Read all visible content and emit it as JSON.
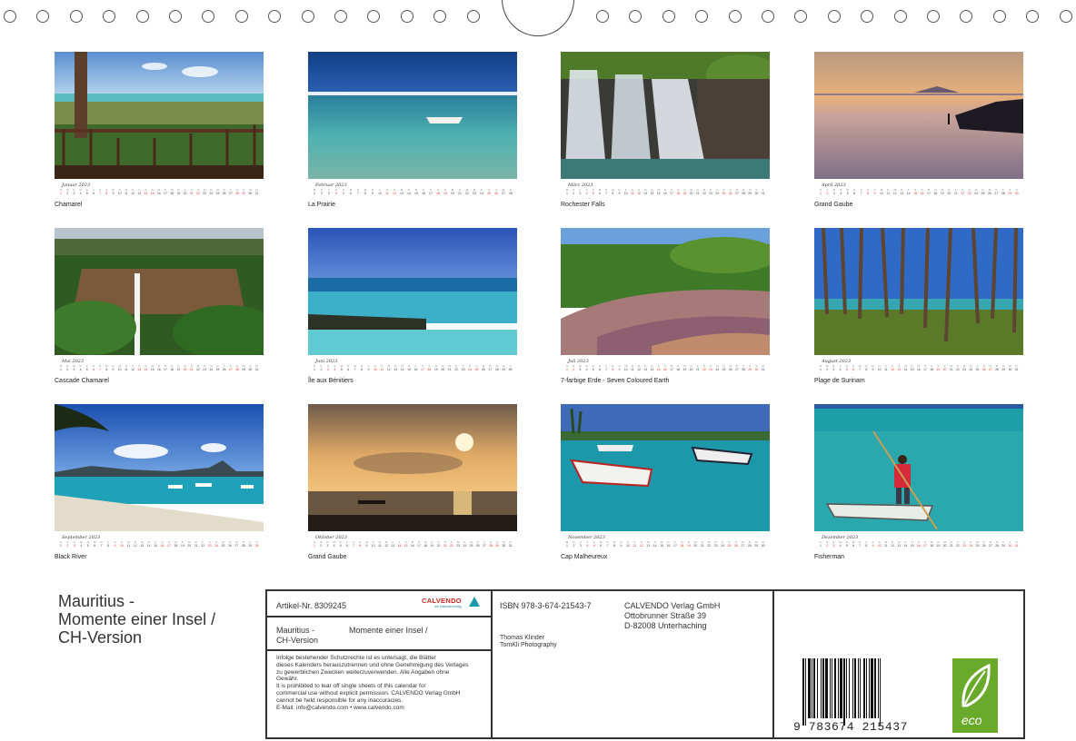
{
  "year": "2023",
  "weekdays": [
    "M",
    "D",
    "M",
    "D",
    "F",
    "S",
    "S"
  ],
  "months": [
    {
      "name": "Januar",
      "caption": "Chamarel",
      "days": 31,
      "start": 6
    },
    {
      "name": "Februar",
      "caption": "La Prairie",
      "days": 28,
      "start": 2
    },
    {
      "name": "März",
      "caption": "Rochester Falls",
      "days": 31,
      "start": 2
    },
    {
      "name": "April",
      "caption": "Grand Gaube",
      "days": 30,
      "start": 5
    },
    {
      "name": "Mai",
      "caption": "Cascade Chamarel",
      "days": 31,
      "start": 0
    },
    {
      "name": "Juni",
      "caption": "Île aux Bénitiers",
      "days": 30,
      "start": 3
    },
    {
      "name": "Juli",
      "caption": "7-farbige Erde - Seven Coloured Earth",
      "days": 31,
      "start": 5
    },
    {
      "name": "August",
      "caption": "Plage de Surinam",
      "days": 31,
      "start": 1
    },
    {
      "name": "September",
      "caption": "Black River",
      "days": 30,
      "start": 4
    },
    {
      "name": "Oktober",
      "caption": "Grand Gaube",
      "days": 31,
      "start": 6
    },
    {
      "name": "November",
      "caption": "Cap Malheureux",
      "days": 30,
      "start": 2
    },
    {
      "name": "Dezember",
      "caption": "Fisherman",
      "days": 31,
      "start": 4
    }
  ],
  "title": {
    "line1": "Mauritius -",
    "line2": "Momente einer Insel /",
    "line3": "CH-Version"
  },
  "info": {
    "article": "Artikel-Nr. 8309245",
    "brand": "CALVENDO",
    "brand_sub": "der Kalenderverlag",
    "sub_title_a": "Mauritius -",
    "sub_title_b": "CH-Version",
    "sub_title_c": "Momente einer Insel /",
    "legal": [
      "Infolge bestehender Schutzrechte ist es untersagt, die Blätter",
      "dieses Kalenders herauszutrennen und ohne Genehmigung des Verlages",
      "zu gewerblichen Zwecken weiterzuverwenden. Alle Angaben ohne",
      "Gewähr.",
      "It is prohibited to tear off single sheets of this calendar for",
      "commercial use without explicit permission. CALVENDO Verlag GmbH",
      "cannot be held responsible for any inaccuracies.",
      "E-Mail: info@calvendo.com • www.calvendo.com"
    ],
    "isbn": "ISBN 978-3-674-21543-7",
    "publisher": [
      "CALVENDO Verlag GmbH",
      "Ottobrunner Straße 39",
      "D-82008 Unterhaching"
    ],
    "author": "Thomas Klinder",
    "author_sub": "TomKli Photography",
    "barcode_digits": "9 783674 215437",
    "eco": "eco"
  },
  "colors": {
    "frame": "#333333",
    "weekend": "#dd3333",
    "eco_green": "#6aaa2a"
  }
}
